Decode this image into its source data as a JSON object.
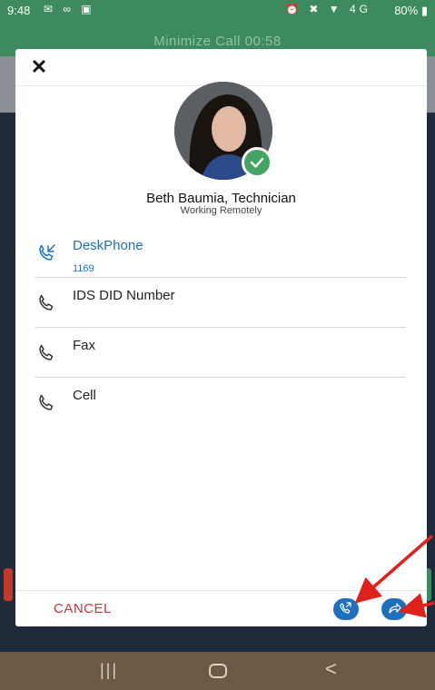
{
  "status_bar": {
    "time": "9:48",
    "left_icons": "✉ ∞ ▣",
    "right_icons": "⏰ ✖ ▼ 4G",
    "battery": "80% ▮"
  },
  "call_banner": {
    "text": "Minimize Call  00:58"
  },
  "dialog": {
    "contact": {
      "name": "Beth Baumia, Technician",
      "status": "Working Remotely",
      "presence": "available"
    },
    "numbers": [
      {
        "label": "DeskPhone",
        "number": "1169",
        "active": true
      },
      {
        "label": "IDS DID Number",
        "number": "",
        "active": false
      },
      {
        "label": "Fax",
        "number": "",
        "active": false
      },
      {
        "label": "Cell",
        "number": "",
        "active": false
      }
    ],
    "cancel_label": "CANCEL",
    "actions": [
      {
        "name": "transfer",
        "icon": "phone-transfer-icon"
      },
      {
        "name": "forward",
        "icon": "forward-arrow-icon"
      }
    ]
  },
  "nav_bar": {
    "recent": "|||",
    "back": "<"
  },
  "colors": {
    "brand_green": "#3c8a5e",
    "accent_blue": "#1f6fbf",
    "cancel_red": "#d0343a",
    "annotation_red": "#e0201b"
  }
}
